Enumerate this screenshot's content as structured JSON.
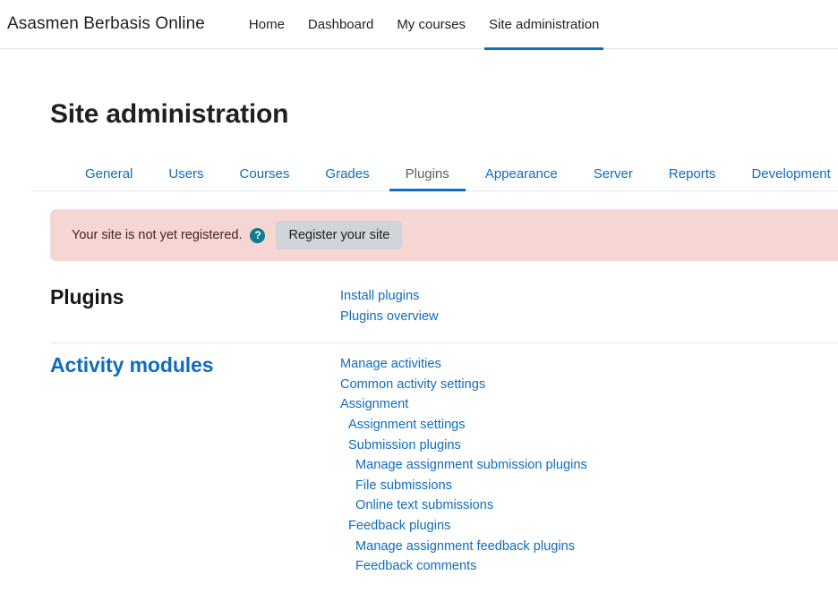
{
  "navbar": {
    "brand": "Asasmen Berbasis Online",
    "links": [
      {
        "label": "Home",
        "active": false
      },
      {
        "label": "Dashboard",
        "active": false
      },
      {
        "label": "My courses",
        "active": false
      },
      {
        "label": "Site administration",
        "active": true
      }
    ]
  },
  "page": {
    "title": "Site administration"
  },
  "tabs": [
    {
      "label": "General",
      "active": false
    },
    {
      "label": "Users",
      "active": false
    },
    {
      "label": "Courses",
      "active": false
    },
    {
      "label": "Grades",
      "active": false
    },
    {
      "label": "Plugins",
      "active": true
    },
    {
      "label": "Appearance",
      "active": false
    },
    {
      "label": "Server",
      "active": false
    },
    {
      "label": "Reports",
      "active": false
    },
    {
      "label": "Development",
      "active": false
    }
  ],
  "alert": {
    "message": "Your site is not yet registered.",
    "help_icon": "question-mark-help-icon",
    "button_label": "Register your site",
    "background_color": "#f5d6d3",
    "help_icon_color": "#0f7c8f",
    "button_color": "#ced4da"
  },
  "sections": [
    {
      "heading": "Plugins",
      "heading_color": "#17181a",
      "links": [
        {
          "label": "Install plugins",
          "indent": 0
        },
        {
          "label": "Plugins overview",
          "indent": 0
        }
      ]
    },
    {
      "heading": "Activity modules",
      "heading_color": "#0f6cbf",
      "links": [
        {
          "label": "Manage activities",
          "indent": 0
        },
        {
          "label": "Common activity settings",
          "indent": 0
        },
        {
          "label": "Assignment",
          "indent": 0
        },
        {
          "label": "Assignment settings",
          "indent": 1
        },
        {
          "label": "Submission plugins",
          "indent": 1
        },
        {
          "label": "Manage assignment submission plugins",
          "indent": 2
        },
        {
          "label": "File submissions",
          "indent": 2
        },
        {
          "label": "Online text submissions",
          "indent": 2
        },
        {
          "label": "Feedback plugins",
          "indent": 1
        },
        {
          "label": "Manage assignment feedback plugins",
          "indent": 2
        },
        {
          "label": "Feedback comments",
          "indent": 2
        }
      ]
    }
  ],
  "theme": {
    "accent": "#0f6cbf",
    "text": "#1d2125",
    "border": "#e3e4e6"
  }
}
